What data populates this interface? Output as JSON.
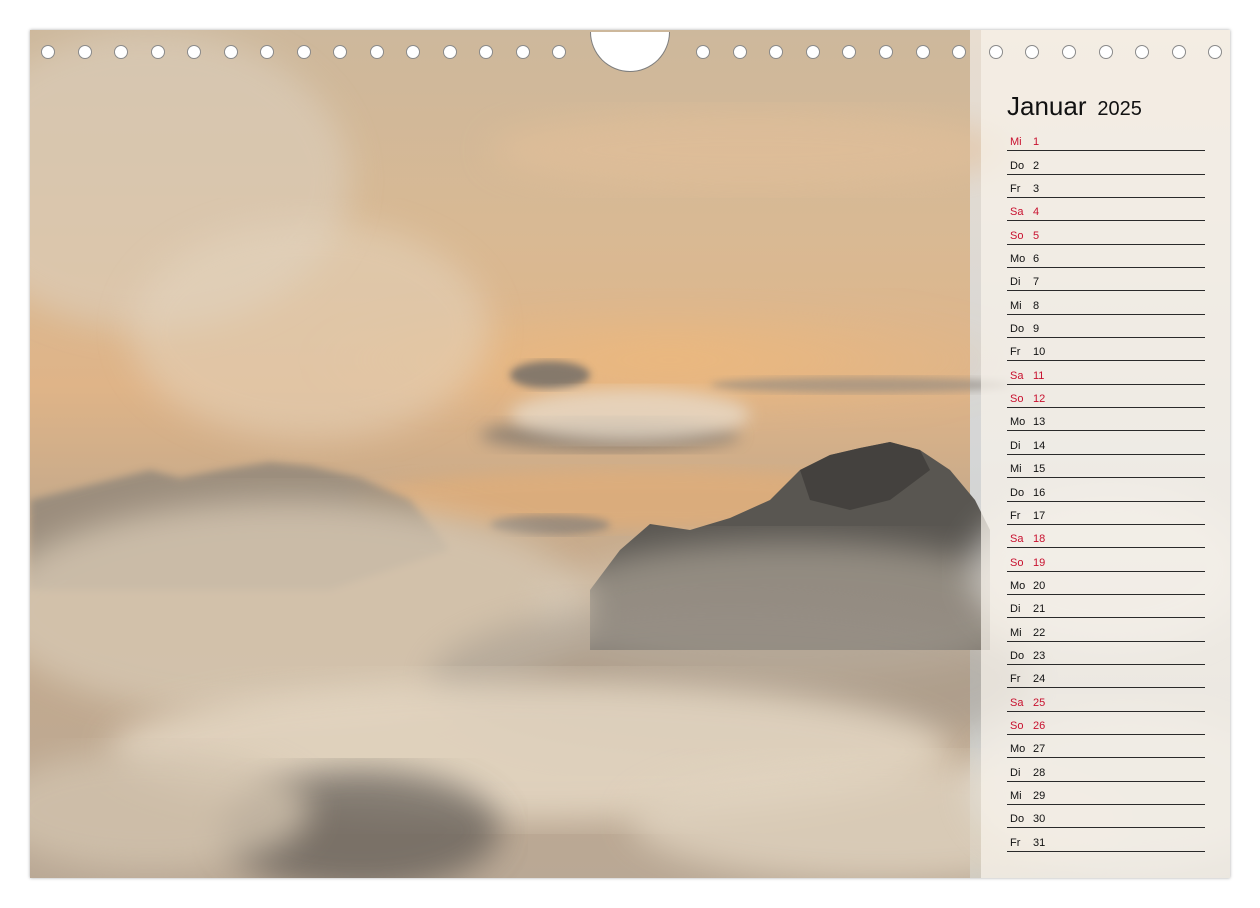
{
  "calendar": {
    "month": "Januar",
    "year": "2025",
    "weekend_color": "#c8102e",
    "days": [
      {
        "wd": "Mi",
        "day": "1",
        "weekend": true
      },
      {
        "wd": "Do",
        "day": "2",
        "weekend": false
      },
      {
        "wd": "Fr",
        "day": "3",
        "weekend": false
      },
      {
        "wd": "Sa",
        "day": "4",
        "weekend": true
      },
      {
        "wd": "So",
        "day": "5",
        "weekend": true
      },
      {
        "wd": "Mo",
        "day": "6",
        "weekend": false
      },
      {
        "wd": "Di",
        "day": "7",
        "weekend": false
      },
      {
        "wd": "Mi",
        "day": "8",
        "weekend": false
      },
      {
        "wd": "Do",
        "day": "9",
        "weekend": false
      },
      {
        "wd": "Fr",
        "day": "10",
        "weekend": false
      },
      {
        "wd": "Sa",
        "day": "11",
        "weekend": true
      },
      {
        "wd": "So",
        "day": "12",
        "weekend": true
      },
      {
        "wd": "Mo",
        "day": "13",
        "weekend": false
      },
      {
        "wd": "Di",
        "day": "14",
        "weekend": false
      },
      {
        "wd": "Mi",
        "day": "15",
        "weekend": false
      },
      {
        "wd": "Do",
        "day": "16",
        "weekend": false
      },
      {
        "wd": "Fr",
        "day": "17",
        "weekend": false
      },
      {
        "wd": "Sa",
        "day": "18",
        "weekend": true
      },
      {
        "wd": "So",
        "day": "19",
        "weekend": true
      },
      {
        "wd": "Mo",
        "day": "20",
        "weekend": false
      },
      {
        "wd": "Di",
        "day": "21",
        "weekend": false
      },
      {
        "wd": "Mi",
        "day": "22",
        "weekend": false
      },
      {
        "wd": "Do",
        "day": "23",
        "weekend": false
      },
      {
        "wd": "Fr",
        "day": "24",
        "weekend": false
      },
      {
        "wd": "Sa",
        "day": "25",
        "weekend": true
      },
      {
        "wd": "So",
        "day": "26",
        "weekend": true
      },
      {
        "wd": "Mo",
        "day": "27",
        "weekend": false
      },
      {
        "wd": "Di",
        "day": "28",
        "weekend": false
      },
      {
        "wd": "Mi",
        "day": "29",
        "weekend": false
      },
      {
        "wd": "Do",
        "day": "30",
        "weekend": false
      },
      {
        "wd": "Fr",
        "day": "31",
        "weekend": false
      }
    ]
  }
}
